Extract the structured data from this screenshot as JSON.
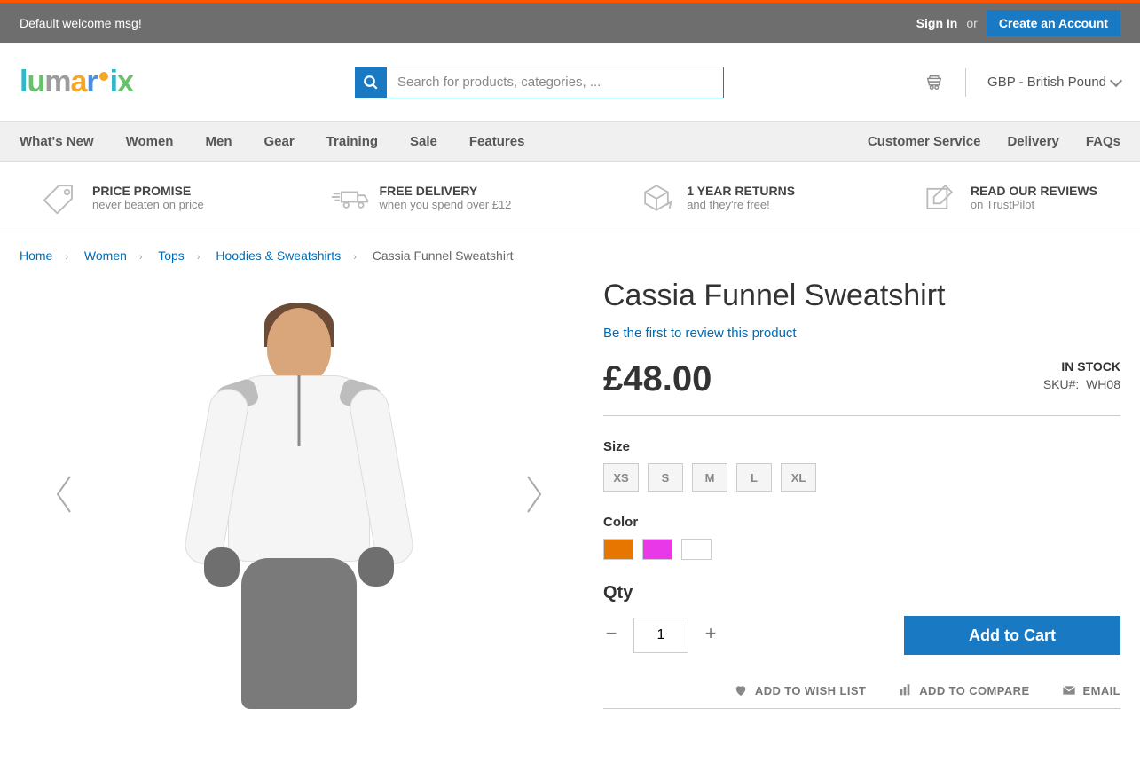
{
  "topbar": {
    "welcome": "Default welcome msg!",
    "signin": "Sign In",
    "or": "or",
    "create_account": "Create an Account"
  },
  "search": {
    "placeholder": "Search for products, categories, ..."
  },
  "currency": {
    "label": "GBP - British Pound"
  },
  "nav": {
    "items": [
      "What's New",
      "Women",
      "Men",
      "Gear",
      "Training",
      "Sale",
      "Features"
    ],
    "right": [
      "Customer Service",
      "Delivery",
      "FAQs"
    ]
  },
  "usp": [
    {
      "title": "PRICE PROMISE",
      "sub": "never beaten on price"
    },
    {
      "title": "FREE DELIVERY",
      "sub": "when you spend over £12"
    },
    {
      "title": "1 YEAR RETURNS",
      "sub": "and they're free!"
    },
    {
      "title": "READ OUR REVIEWS",
      "sub": "on TrustPilot"
    }
  ],
  "breadcrumb": {
    "links": [
      "Home",
      "Women",
      "Tops",
      "Hoodies & Sweatshirts"
    ],
    "current": "Cassia Funnel Sweatshirt"
  },
  "product": {
    "title": "Cassia Funnel Sweatshirt",
    "review_link": "Be the first to review this product",
    "price": "£48.00",
    "stock": "IN STOCK",
    "sku_label": "SKU#:",
    "sku": "WH08",
    "size_label": "Size",
    "sizes": [
      "XS",
      "S",
      "M",
      "L",
      "XL"
    ],
    "color_label": "Color",
    "colors": [
      "#e77600",
      "#e838e8",
      "#ffffff"
    ],
    "qty_label": "Qty",
    "qty_value": "1",
    "add_to_cart": "Add to Cart",
    "actions": {
      "wishlist": "ADD TO WISH LIST",
      "compare": "ADD TO COMPARE",
      "email": "EMAIL"
    }
  }
}
